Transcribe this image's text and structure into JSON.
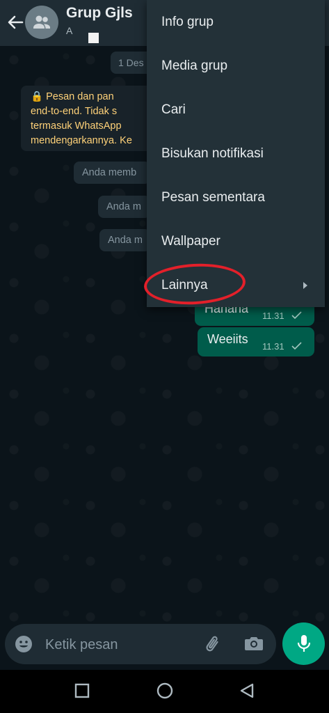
{
  "header": {
    "title": "Grup Gjls",
    "subtitle": "A"
  },
  "chat": {
    "date_chip": "1 Des",
    "e2e_notice": "🔒 Pesan dan pan\nend-to-end. Tidak s\ntermasuk WhatsApp\nmendengarkannya. Ke",
    "system_messages": [
      "Anda memb",
      "Anda m",
      "Anda m"
    ],
    "outgoing_messages": [
      {
        "text": "Hahaha",
        "time": "11.31"
      },
      {
        "text": "Weeiits",
        "time": "11.31"
      }
    ]
  },
  "menu": {
    "items": [
      {
        "label": "Info grup"
      },
      {
        "label": "Media grup"
      },
      {
        "label": "Cari"
      },
      {
        "label": "Bisukan notifikasi"
      },
      {
        "label": "Pesan sementara"
      },
      {
        "label": "Wallpaper"
      },
      {
        "label": "Lainnya"
      }
    ]
  },
  "composer": {
    "placeholder": "Ketik pesan"
  },
  "colors": {
    "accent": "#00a884",
    "outgoing_bubble": "#005c4b",
    "annotation_red": "#e3202a"
  },
  "icons": [
    "back-arrow-icon",
    "group-avatar-icon",
    "emoji-icon",
    "paperclip-icon",
    "camera-icon",
    "mic-icon",
    "chevron-right-icon",
    "square-nav-icon",
    "circle-nav-icon",
    "triangle-back-icon"
  ]
}
